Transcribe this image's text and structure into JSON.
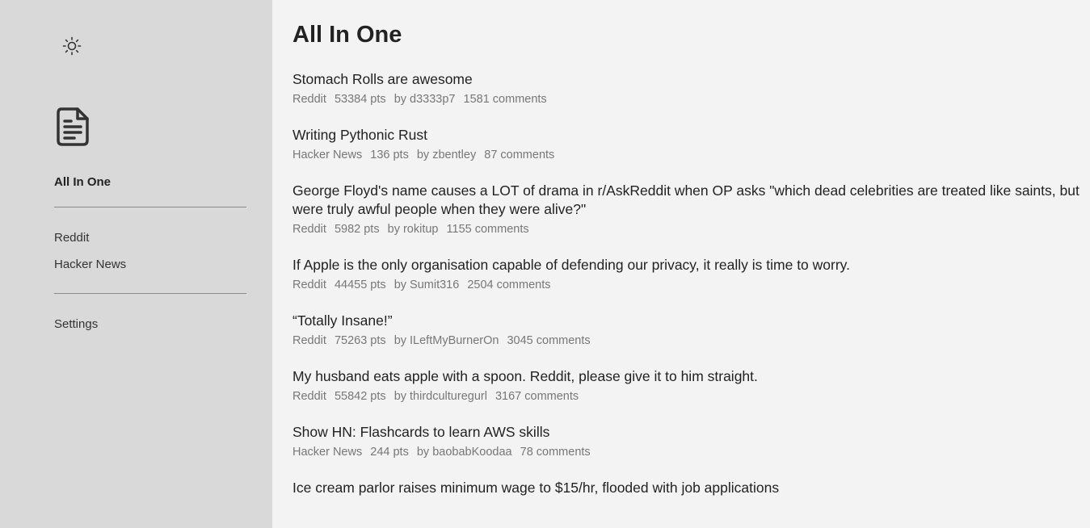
{
  "sidebar": {
    "theme_icon": "sun-icon",
    "logo_icon": "document-icon",
    "active_label": "All In One",
    "sources": [
      {
        "label": "Reddit"
      },
      {
        "label": "Hacker News"
      }
    ],
    "settings_label": "Settings"
  },
  "main": {
    "title": "All In One",
    "items": [
      {
        "title": "Stomach Rolls are awesome",
        "source": "Reddit",
        "points": "53384 pts",
        "author": "by d3333p7",
        "comments": "1581 comments"
      },
      {
        "title": "Writing Pythonic Rust",
        "source": "Hacker News",
        "points": "136 pts",
        "author": "by zbentley",
        "comments": "87 comments"
      },
      {
        "title": "George Floyd's name causes a LOT of drama in r/AskReddit when OP asks \"which dead celebrities are treated like saints, but were truly awful people when they were alive?\"",
        "source": "Reddit",
        "points": "5982 pts",
        "author": "by rokitup",
        "comments": "1155 comments"
      },
      {
        "title": "If Apple is the only organisation capable of defending our privacy, it really is time to worry.",
        "source": "Reddit",
        "points": "44455 pts",
        "author": "by Sumit316",
        "comments": "2504 comments"
      },
      {
        "title": "“Totally Insane!”",
        "source": "Reddit",
        "points": "75263 pts",
        "author": "by ILeftMyBurnerOn",
        "comments": "3045 comments"
      },
      {
        "title": "My husband eats apple with a spoon. Reddit, please give it to him straight.",
        "source": "Reddit",
        "points": "55842 pts",
        "author": "by thirdculturegurl",
        "comments": "3167 comments"
      },
      {
        "title": "Show HN: Flashcards to learn AWS skills",
        "source": "Hacker News",
        "points": "244 pts",
        "author": "by baobabKoodaa",
        "comments": "78 comments"
      },
      {
        "title": "Ice cream parlor raises minimum wage to $15/hr, flooded with job applications",
        "source": "",
        "points": "",
        "author": "",
        "comments": ""
      }
    ]
  }
}
